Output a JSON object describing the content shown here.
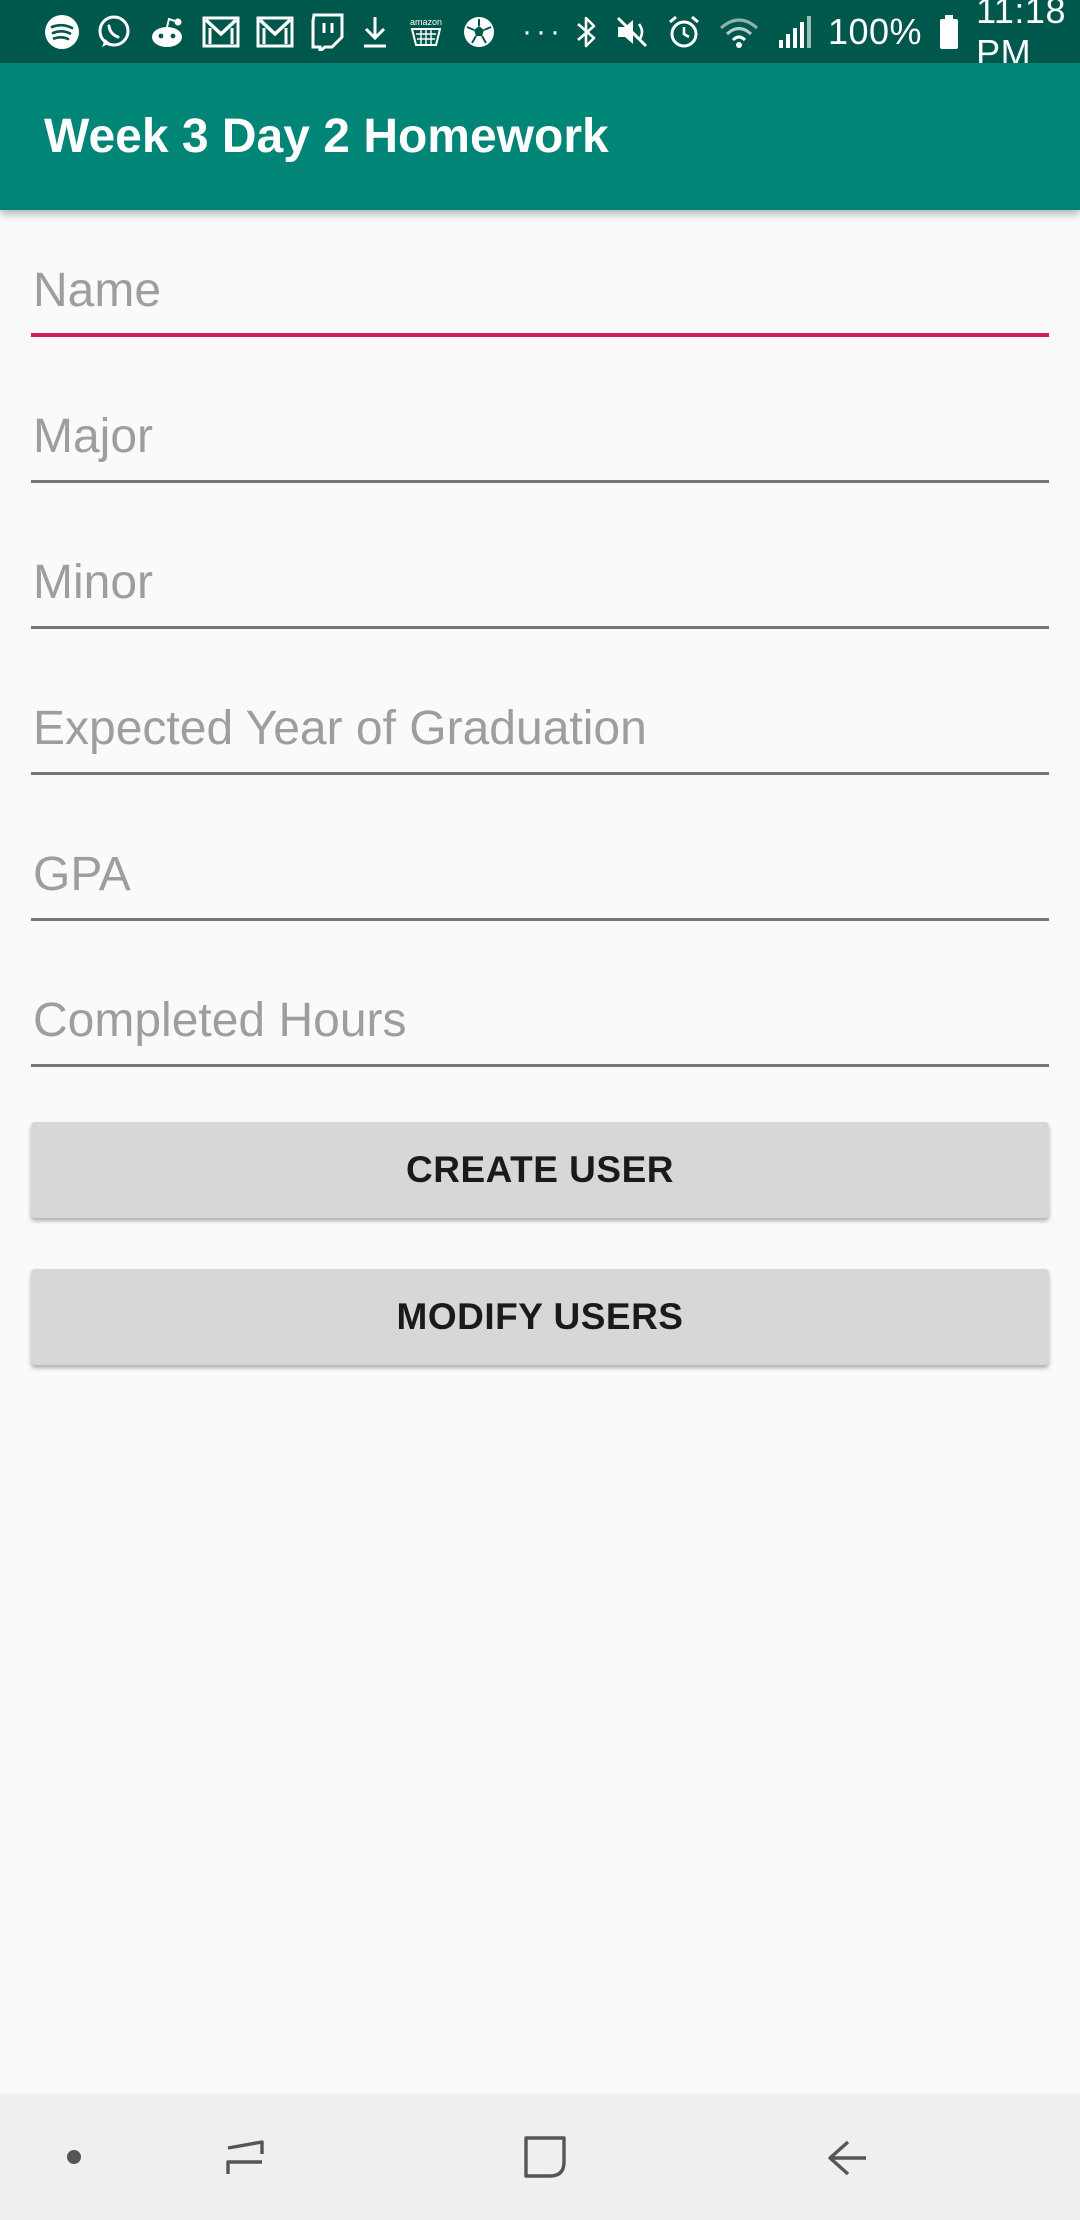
{
  "status_bar": {
    "left_icons": [
      "spotify-icon",
      "whatsapp-icon",
      "reddit-icon",
      "gmail-icon",
      "gmail-icon",
      "twitch-icon",
      "download-icon",
      "amazon-icon",
      "soccer-ball-icon"
    ],
    "overflow": "···",
    "right_icons": [
      "bluetooth-icon",
      "mute-icon",
      "alarm-icon",
      "wifi-icon",
      "signal-icon"
    ],
    "battery": "100%",
    "time": "11:18 PM"
  },
  "app_bar": {
    "title": "Week 3 Day 2 Homework"
  },
  "form": {
    "fields": [
      {
        "placeholder": "Name",
        "value": "",
        "focused": true
      },
      {
        "placeholder": "Major",
        "value": ""
      },
      {
        "placeholder": "Minor",
        "value": ""
      },
      {
        "placeholder": "Expected Year of Graduation",
        "value": ""
      },
      {
        "placeholder": "GPA",
        "value": ""
      },
      {
        "placeholder": "Completed Hours",
        "value": ""
      }
    ]
  },
  "buttons": {
    "create_user": "CREATE USER",
    "modify_users": "MODIFY USERS"
  },
  "nav_bar": {
    "icons": [
      "dot-icon",
      "recents-icon",
      "home-icon",
      "back-icon"
    ]
  },
  "colors": {
    "status_bar": "#00574b",
    "app_bar": "#008577",
    "accent": "#d81b60",
    "button": "#d6d7d7",
    "background": "#fafafa"
  }
}
